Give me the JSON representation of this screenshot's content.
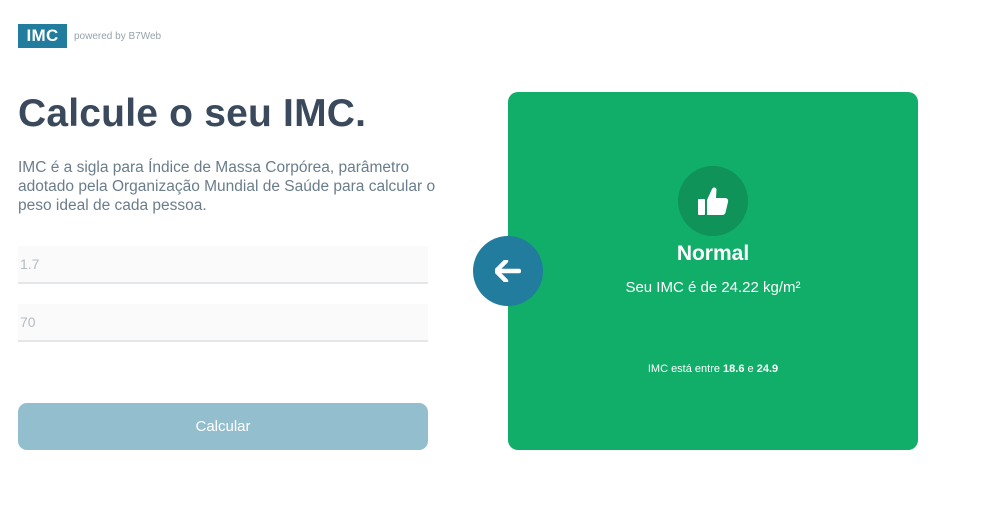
{
  "header": {
    "logo_text": "IMC",
    "powered_by": "powered by B7Web"
  },
  "intro": {
    "title": "Calcule o seu IMC.",
    "description": "IMC é a sigla para Índice de Massa Corpórea, parâmetro adotado pela Organização Mundial de Saúde para calcular o peso ideal de cada pessoa."
  },
  "form": {
    "height_value": "1.7",
    "weight_value": "70",
    "calculate_label": "Calcular"
  },
  "result": {
    "status": "Normal",
    "imc_text": "Seu IMC é de 24.22 kg/m²",
    "range_prefix": "IMC está entre",
    "range_min": "18.6",
    "range_join": "e",
    "range_max": "24.9",
    "icon": "thumbs-up-icon",
    "color": "#10ae68"
  },
  "back_button": {
    "icon": "arrow-left-icon",
    "color": "#227c9d"
  }
}
